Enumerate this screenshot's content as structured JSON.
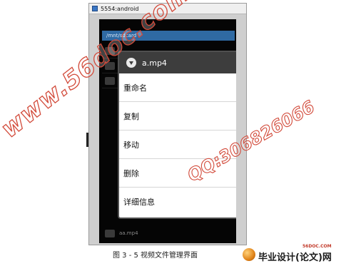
{
  "window": {
    "title": "5554:android"
  },
  "screen": {
    "path": "/mnt/sdcard",
    "bottom_file": "aa.mp4"
  },
  "dialog": {
    "title": "a.mp4",
    "items": [
      {
        "label": "重命名"
      },
      {
        "label": "复制"
      },
      {
        "label": "移动"
      },
      {
        "label": "删除"
      },
      {
        "label": "详细信息"
      }
    ]
  },
  "watermark": {
    "main": "www.56doc.com",
    "qq": "QQ:306826066"
  },
  "caption": "图 3 - 5  视频文件管理界面",
  "brand": {
    "url": "56DOC.COM",
    "text": "毕业设计(论文)网"
  },
  "colors": {
    "path_bar": "#2f6aa3",
    "dialog_header": "#3d3d3d",
    "watermark_stroke": "#d24a3a"
  }
}
